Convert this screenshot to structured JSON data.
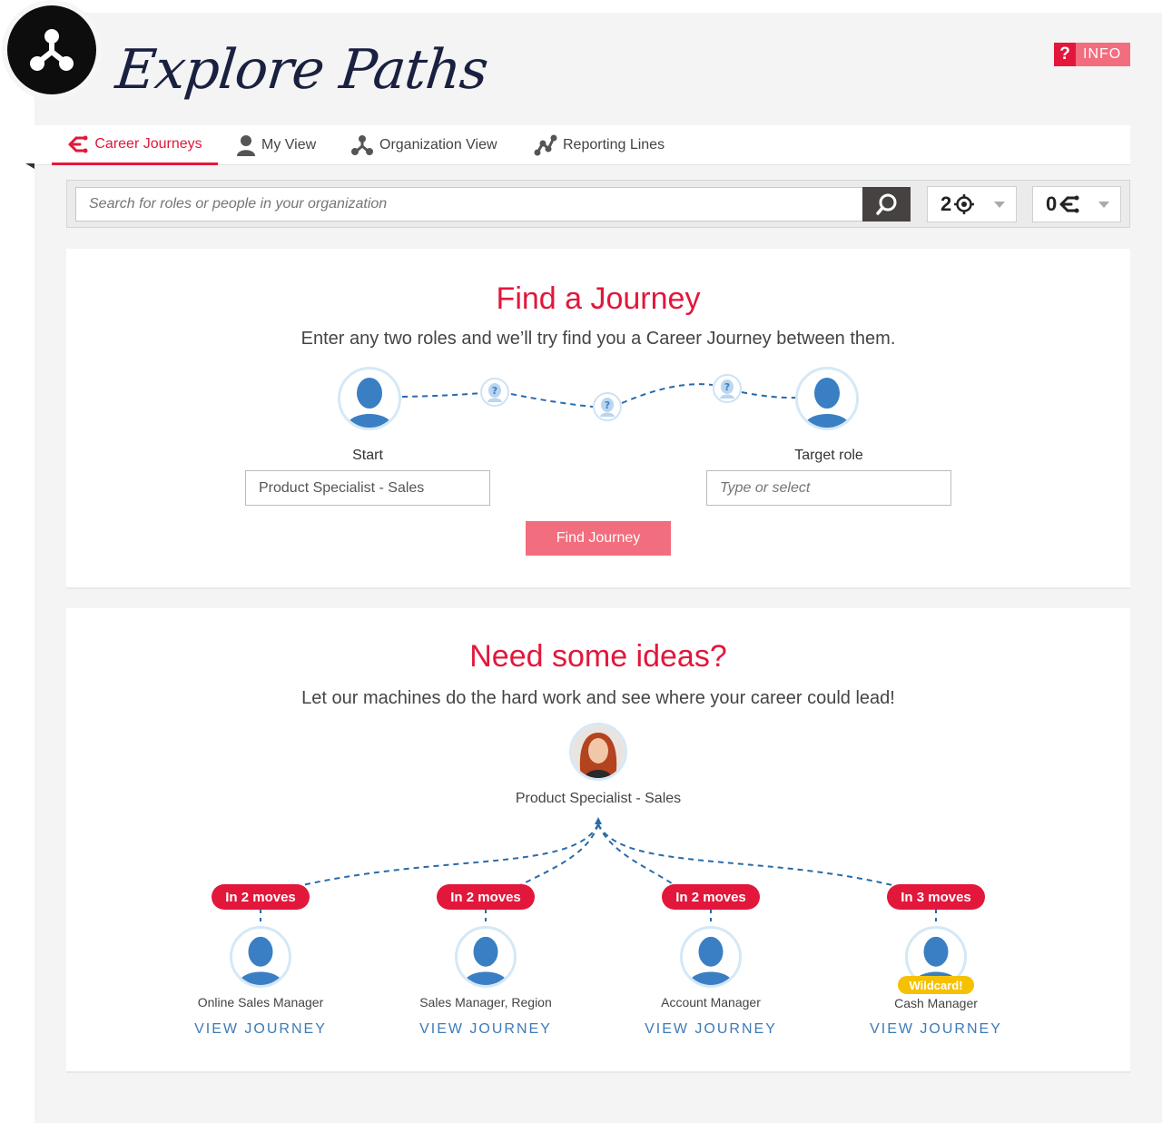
{
  "app": {
    "title": "Explore Paths",
    "info_label": "INFO",
    "info_icon_text": "?"
  },
  "nav": {
    "tabs": [
      {
        "label": "Career Journeys",
        "icon": "career-journeys-icon",
        "active": true
      },
      {
        "label": "My View",
        "icon": "person-icon",
        "active": false
      },
      {
        "label": "Organization View",
        "icon": "organization-icon",
        "active": false
      },
      {
        "label": "Reporting Lines",
        "icon": "reporting-lines-icon",
        "active": false
      }
    ]
  },
  "search": {
    "placeholder": "Search for roles or people in your organization",
    "targets_count": "2",
    "journeys_count": "0"
  },
  "find_journey": {
    "title": "Find a Journey",
    "subtitle": "Enter any two roles and we’ll try find you a Career Journey between them.",
    "start_label": "Start",
    "start_value": "Product Specialist - Sales",
    "target_label": "Target role",
    "target_placeholder": "Type or select",
    "button_label": "Find Journey"
  },
  "ideas": {
    "title": "Need some ideas?",
    "subtitle": "Let our machines do the hard work and see where your career could lead!",
    "current_role": "Product Specialist - Sales",
    "suggestions": [
      {
        "moves": "In 2 moves",
        "role": "Online Sales Manager",
        "link": "VIEW JOURNEY",
        "wildcard": ""
      },
      {
        "moves": "In 2 moves",
        "role": "Sales Manager, Region",
        "link": "VIEW JOURNEY",
        "wildcard": ""
      },
      {
        "moves": "In 2 moves",
        "role": "Account Manager",
        "link": "VIEW JOURNEY",
        "wildcard": ""
      },
      {
        "moves": "In 3 moves",
        "role": "Cash Manager",
        "link": "VIEW JOURNEY",
        "wildcard": "Wildcard!"
      }
    ]
  },
  "colors": {
    "accent": "#e2173b",
    "button_pink": "#f26d7d",
    "link_blue": "#3d7bb5",
    "avatar_blue": "#3a7fc4",
    "wildcard_yellow": "#f5c100"
  }
}
